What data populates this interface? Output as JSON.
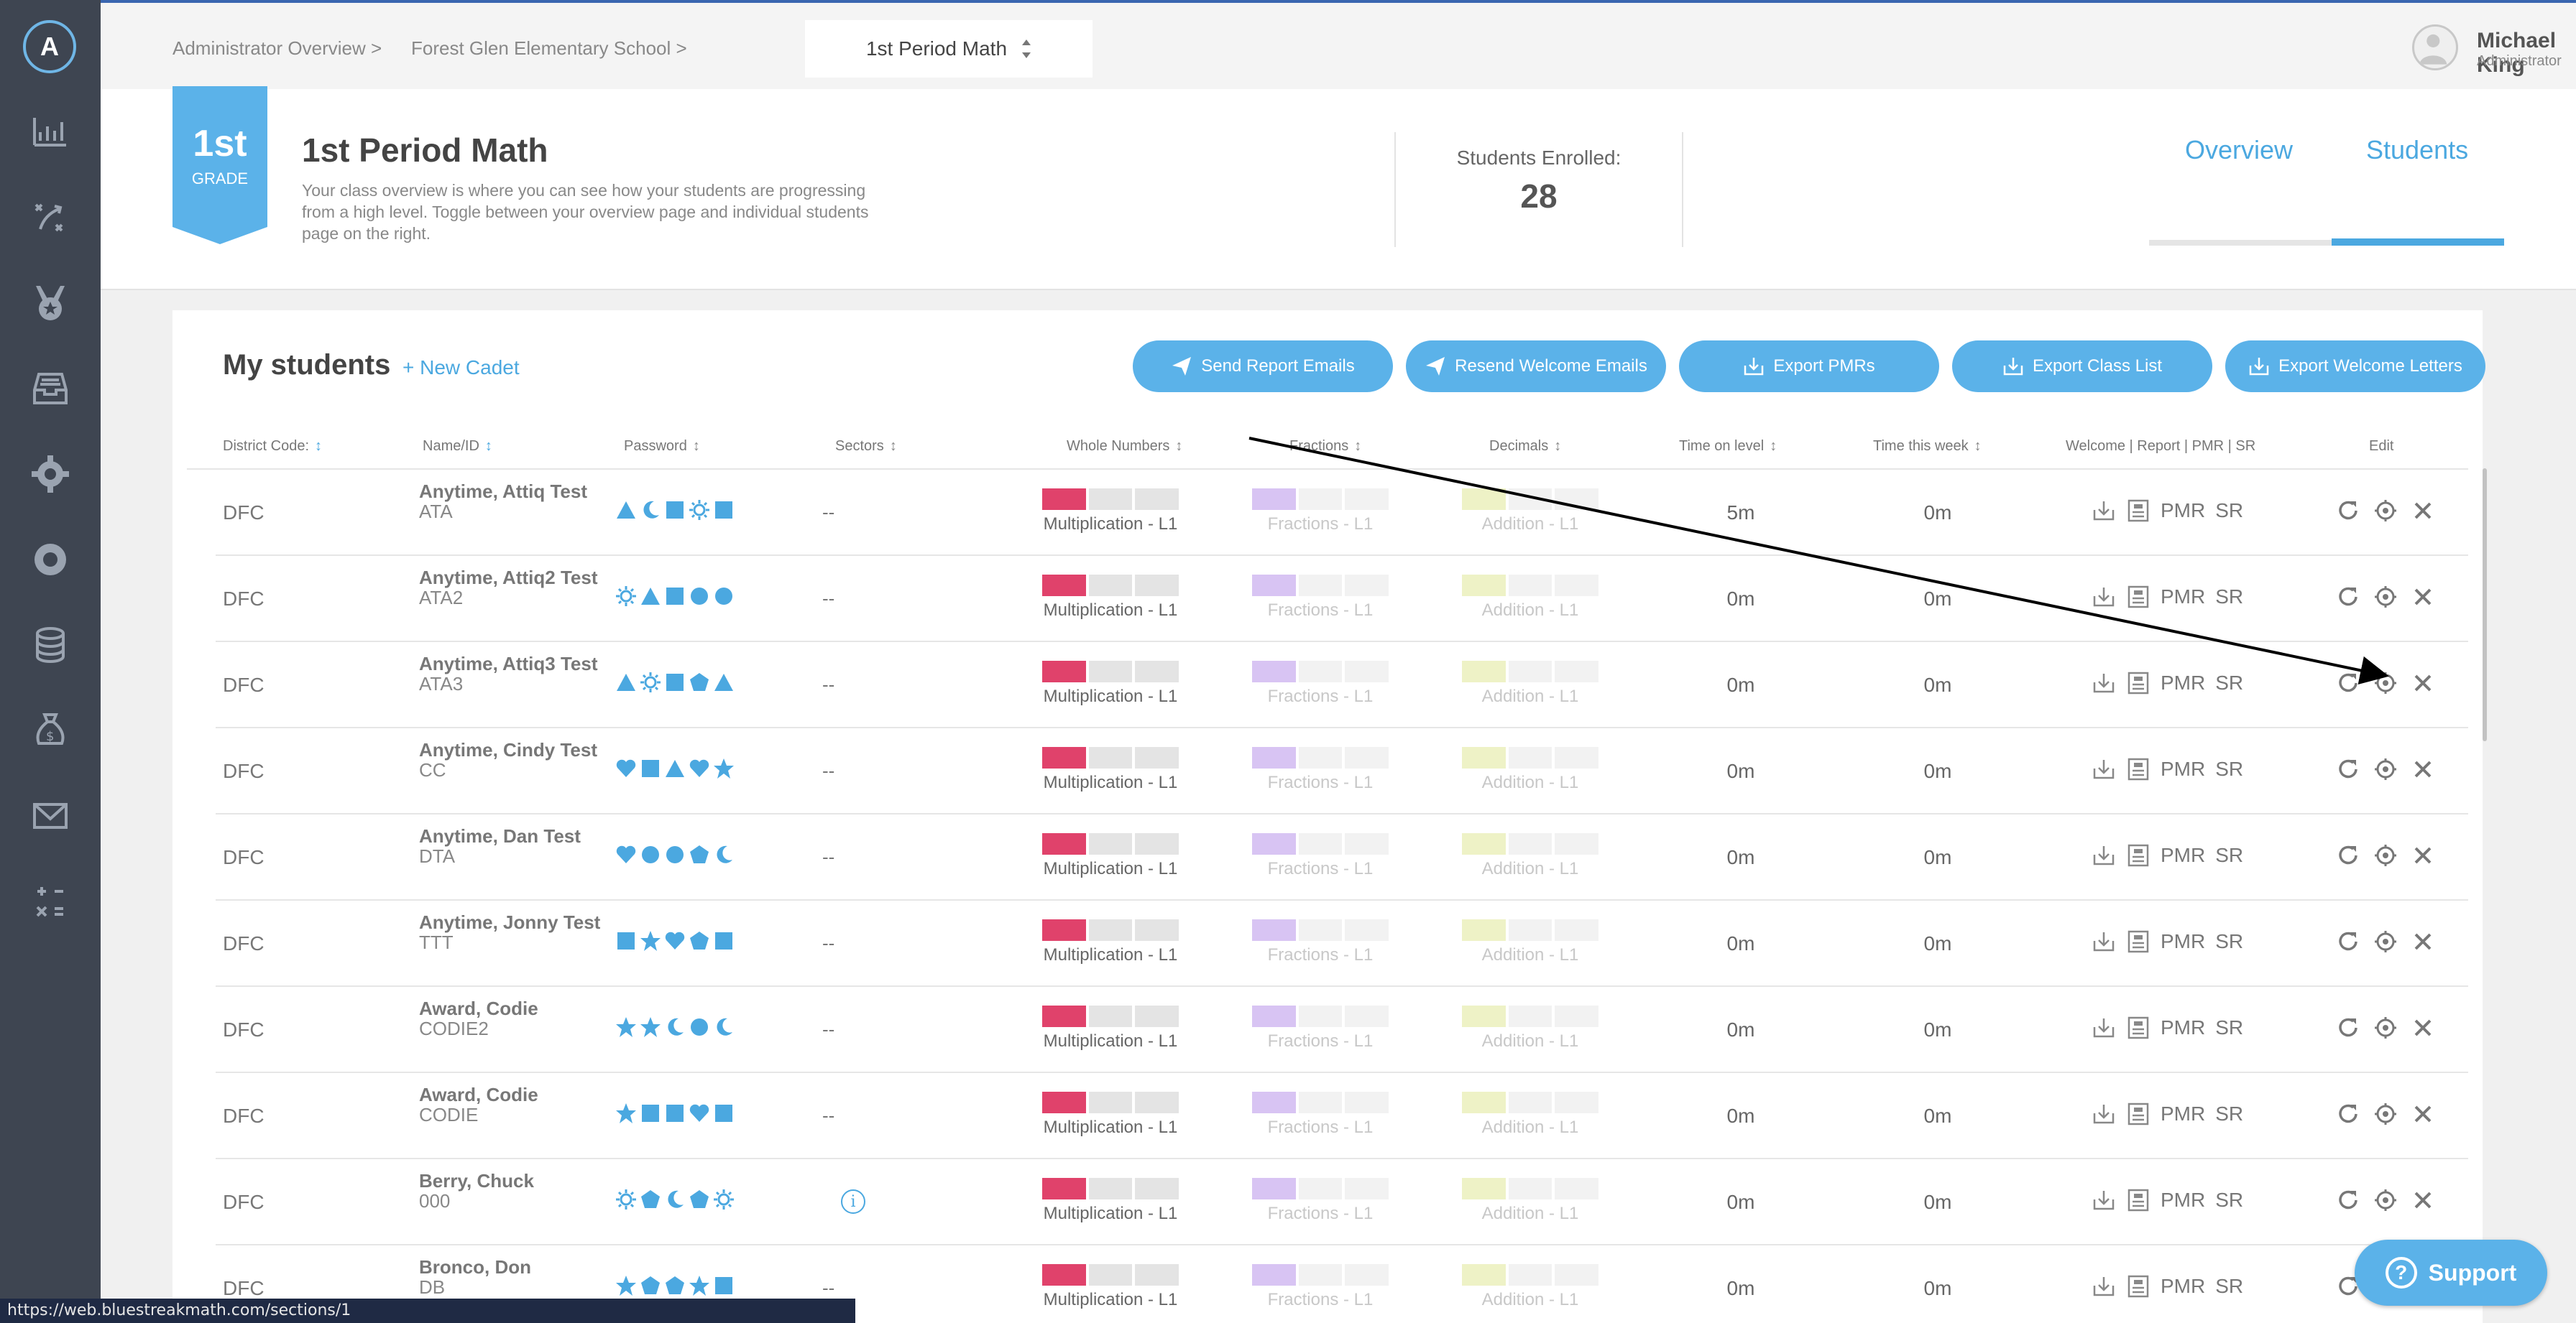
{
  "colors": {
    "accent": "#4ba8e0",
    "button": "#5bb2e9",
    "rail": "#3e4551",
    "whole": "#e0426b",
    "fractions": "#d8c4f3",
    "decimals": "#eef2c6",
    "empty": "#e4e4e4",
    "faint": "#f2f2f2"
  },
  "rail": {
    "logo_letter": "A",
    "icons": [
      "bar-chart-icon",
      "strategy-icon",
      "medal-icon",
      "inbox-icon",
      "gear-icon",
      "lifebuoy-icon",
      "database-icon",
      "money-bag-icon",
      "mail-icon",
      "math-symbols-icon"
    ]
  },
  "breadcrumb": {
    "items": [
      "Administrator Overview",
      "Forest Glen Elementary School"
    ],
    "separator": ">",
    "current": "1st Period Math"
  },
  "user": {
    "name": "Michael King",
    "role": "Administrator"
  },
  "class": {
    "grade_number": "1st",
    "grade_label": "GRADE",
    "title": "1st Period Math",
    "description": "Your class overview is where you can see how your students are progressing from a high level. Toggle between your overview page and individual students page on the right.",
    "enrolled_label": "Students Enrolled:",
    "enrolled_value": "28",
    "tabs": [
      {
        "label": "Overview",
        "active": false
      },
      {
        "label": "Students",
        "active": true
      }
    ]
  },
  "students": {
    "title": "My students",
    "new_cadet": "+ New Cadet",
    "actions": [
      "Send Report Emails",
      "Resend Welcome Emails",
      "Export PMRs",
      "Export Class List",
      "Export Welcome Letters"
    ],
    "columns": [
      "District Code:",
      "Name/ID",
      "Password",
      "Sectors",
      "Whole Numbers",
      "Fractions",
      "Decimals",
      "Time on level",
      "Time this week",
      "Welcome | Report | PMR | SR",
      "Edit"
    ],
    "report_labels": {
      "pmr": "PMR",
      "sr": "SR"
    },
    "rows": [
      {
        "code": "DFC",
        "name": "Anytime, Attiq Test",
        "id": "ATA",
        "password": [
          "triangle",
          "moon",
          "square",
          "sun",
          "square"
        ],
        "sector": "--",
        "whole": "Multiplication - L1",
        "fractions": "Fractions - L1",
        "decimals": "Addition - L1",
        "time_level": "5m",
        "time_week": "0m"
      },
      {
        "code": "DFC",
        "name": "Anytime, Attiq2 Test",
        "id": "ATA2",
        "password": [
          "sun",
          "triangle",
          "square",
          "circle",
          "circle"
        ],
        "sector": "--",
        "whole": "Multiplication - L1",
        "fractions": "Fractions - L1",
        "decimals": "Addition - L1",
        "time_level": "0m",
        "time_week": "0m"
      },
      {
        "code": "DFC",
        "name": "Anytime, Attiq3 Test",
        "id": "ATA3",
        "password": [
          "triangle",
          "sun",
          "square",
          "pentagon",
          "triangle"
        ],
        "sector": "--",
        "whole": "Multiplication - L1",
        "fractions": "Fractions - L1",
        "decimals": "Addition - L1",
        "time_level": "0m",
        "time_week": "0m"
      },
      {
        "code": "DFC",
        "name": "Anytime, Cindy Test",
        "id": "CC",
        "password": [
          "heart",
          "square",
          "triangle",
          "heart",
          "star"
        ],
        "sector": "--",
        "whole": "Multiplication - L1",
        "fractions": "Fractions - L1",
        "decimals": "Addition - L1",
        "time_level": "0m",
        "time_week": "0m"
      },
      {
        "code": "DFC",
        "name": "Anytime, Dan Test",
        "id": "DTA",
        "password": [
          "heart",
          "circle",
          "circle",
          "pentagon",
          "moon"
        ],
        "sector": "--",
        "whole": "Multiplication - L1",
        "fractions": "Fractions - L1",
        "decimals": "Addition - L1",
        "time_level": "0m",
        "time_week": "0m"
      },
      {
        "code": "DFC",
        "name": "Anytime, Jonny Test",
        "id": "TTT",
        "password": [
          "square",
          "star",
          "heart",
          "pentagon",
          "square"
        ],
        "sector": "--",
        "whole": "Multiplication - L1",
        "fractions": "Fractions - L1",
        "decimals": "Addition - L1",
        "time_level": "0m",
        "time_week": "0m"
      },
      {
        "code": "DFC",
        "name": "Award, Codie",
        "id": "CODIE2",
        "password": [
          "star",
          "star",
          "moon",
          "circle",
          "moon"
        ],
        "sector": "--",
        "whole": "Multiplication - L1",
        "fractions": "Fractions - L1",
        "decimals": "Addition - L1",
        "time_level": "0m",
        "time_week": "0m"
      },
      {
        "code": "DFC",
        "name": "Award, Codie",
        "id": "CODIE",
        "password": [
          "star",
          "square",
          "square",
          "heart",
          "square"
        ],
        "sector": "--",
        "whole": "Multiplication - L1",
        "fractions": "Fractions - L1",
        "decimals": "Addition - L1",
        "time_level": "0m",
        "time_week": "0m"
      },
      {
        "code": "DFC",
        "name": "Berry, Chuck",
        "id": "000",
        "password": [
          "sun",
          "pentagon",
          "moon",
          "pentagon",
          "sun"
        ],
        "sector": "info",
        "whole": "Multiplication - L1",
        "fractions": "Fractions - L1",
        "decimals": "Addition - L1",
        "time_level": "0m",
        "time_week": "0m"
      },
      {
        "code": "DFC",
        "name": "Bronco, Don",
        "id": "DB",
        "password": [
          "star",
          "pentagon",
          "pentagon",
          "star",
          "square"
        ],
        "sector": "--",
        "whole": "Multiplication - L1",
        "fractions": "Fractions - L1",
        "decimals": "Addition - L1",
        "time_level": "0m",
        "time_week": "0m"
      }
    ]
  },
  "support_label": "Support",
  "status_url": "https://web.bluestreakmath.com/sections/1"
}
